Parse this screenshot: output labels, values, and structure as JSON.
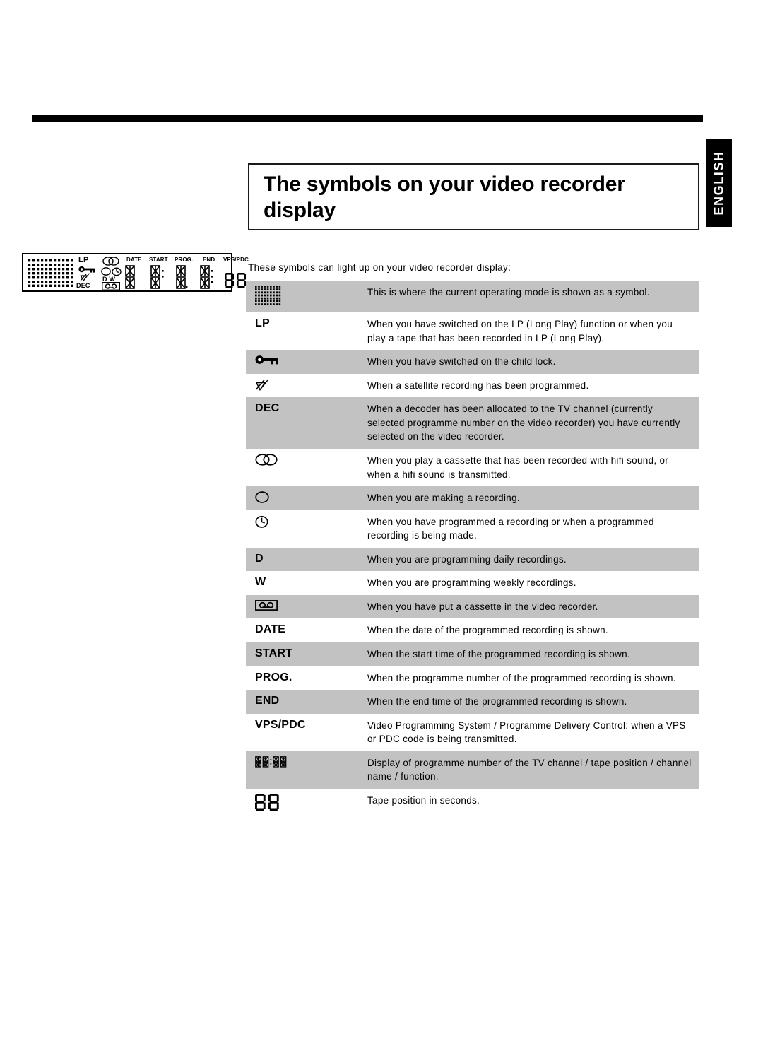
{
  "page": {
    "language_tab": "ENGLISH",
    "title": "The symbols on your video recorder display",
    "intro": "These symbols can light up on your video recorder display:"
  },
  "display_figure": {
    "name": "video-recorder-display-panel",
    "dotmatrix_label": "dot-matrix-area",
    "lp": "LP",
    "dec": "DEC",
    "d": "D",
    "w": "W",
    "segment_labels": [
      "DATE",
      "START",
      "PROG.",
      "END",
      "VPS/PDC"
    ],
    "icons": [
      "dot-matrix",
      "key",
      "satellite-dish",
      "hifi",
      "record",
      "clock",
      "cassette",
      "14-segment-digits",
      "7-segment-digits"
    ]
  },
  "symbol_table": {
    "rows": [
      {
        "symbol_kind": "dot-matrix-icon",
        "symbol_text": "",
        "description": "This is where the current operating mode is shown as a symbol.",
        "shaded": true
      },
      {
        "symbol_kind": "text",
        "symbol_text": "LP",
        "description": "When you have switched on the LP (Long Play) function or when you play a tape that has been recorded in LP (Long Play).",
        "shaded": false
      },
      {
        "symbol_kind": "key-icon",
        "symbol_text": "",
        "description": "When you have switched on the child lock.",
        "shaded": true
      },
      {
        "symbol_kind": "satellite-dish-icon",
        "symbol_text": "",
        "description": "When a satellite recording has been programmed.",
        "shaded": false
      },
      {
        "symbol_kind": "text",
        "symbol_text": "DEC",
        "description": "When a decoder has been allocated to the TV channel (currently selected programme number on the video recorder) you have currently selected on the video recorder.",
        "shaded": true
      },
      {
        "symbol_kind": "hifi-icon",
        "symbol_text": "",
        "description": "When you play a cassette that has been recorded with hifi sound, or when a hifi sound is transmitted.",
        "shaded": false
      },
      {
        "symbol_kind": "record-icon",
        "symbol_text": "",
        "description": "When you are making a recording.",
        "shaded": true
      },
      {
        "symbol_kind": "clock-icon",
        "symbol_text": "",
        "description": "When you have programmed a recording or when a programmed recording is being made.",
        "shaded": false
      },
      {
        "symbol_kind": "text",
        "symbol_text": "D",
        "description": "When you are programming daily recordings.",
        "shaded": true
      },
      {
        "symbol_kind": "text",
        "symbol_text": "W",
        "description": "When you are programming weekly recordings.",
        "shaded": false
      },
      {
        "symbol_kind": "cassette-icon",
        "symbol_text": "",
        "description": "When you have put a cassette in the video recorder.",
        "shaded": true
      },
      {
        "symbol_kind": "text",
        "symbol_text": "DATE",
        "description": "When the date of the programmed recording is shown.",
        "shaded": false
      },
      {
        "symbol_kind": "text",
        "symbol_text": "START",
        "description": "When the start time of the programmed recording is shown.",
        "shaded": true
      },
      {
        "symbol_kind": "text",
        "symbol_text": "PROG.",
        "description": "When the programme number of the programmed recording is shown.",
        "shaded": false
      },
      {
        "symbol_kind": "text",
        "symbol_text": "END",
        "description": "When the end time of the programmed recording is shown.",
        "shaded": true
      },
      {
        "symbol_kind": "text",
        "symbol_text": "VPS/PDC",
        "description": "Video Programming System / Programme Delivery Control: when a VPS or PDC code is being transmitted.",
        "shaded": false
      },
      {
        "symbol_kind": "segment-digits-small-icon",
        "symbol_text": "",
        "description": "Display of programme number of the TV channel / tape position / channel name / function.",
        "shaded": true
      },
      {
        "symbol_kind": "segment-digits-large-icon",
        "symbol_text": "",
        "description": "Tape position in seconds.",
        "shaded": false
      }
    ]
  }
}
